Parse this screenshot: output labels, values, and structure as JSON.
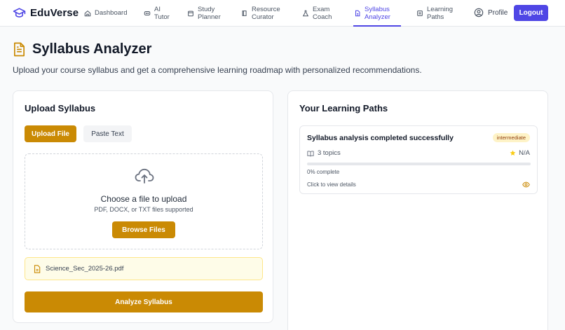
{
  "app": {
    "name": "EduVerse",
    "accent": "#4f46e5",
    "gold": "#ca8a04"
  },
  "nav": {
    "items": [
      {
        "label": "Dashboard",
        "icon": "home-icon"
      },
      {
        "label": "AI\nTutor",
        "icon": "chat-icon"
      },
      {
        "label": "Study\nPlanner",
        "icon": "calendar-icon"
      },
      {
        "label": "Resource\nCurator",
        "icon": "book-icon"
      },
      {
        "label": "Exam\nCoach",
        "icon": "flask-icon"
      },
      {
        "label": "Syllabus\nAnalyzer",
        "icon": "document-icon",
        "active": true
      },
      {
        "label": "Learning\nPaths",
        "icon": "path-icon"
      }
    ],
    "profile": "Profile",
    "logout": "Logout"
  },
  "page": {
    "title": "Syllabus Analyzer",
    "subtitle": "Upload your course syllabus and get a comprehensive learning roadmap with personalized recommendations."
  },
  "upload": {
    "title": "Upload Syllabus",
    "tab_file": "Upload File",
    "tab_paste": "Paste Text",
    "dropzone_title": "Choose a file to upload",
    "dropzone_sub": "PDF, DOCX, or TXT files supported",
    "browse": "Browse Files",
    "file_name": "Science_Sec_2025-26.pdf",
    "analyze": "Analyze Syllabus"
  },
  "paths": {
    "title": "Your Learning Paths",
    "item": {
      "title": "Syllabus analysis completed successfully",
      "level": "intermediate",
      "topics": "3 topics",
      "rating": "N/A",
      "progress": 0,
      "progress_label": "0% complete",
      "hint": "Click to view details"
    }
  }
}
